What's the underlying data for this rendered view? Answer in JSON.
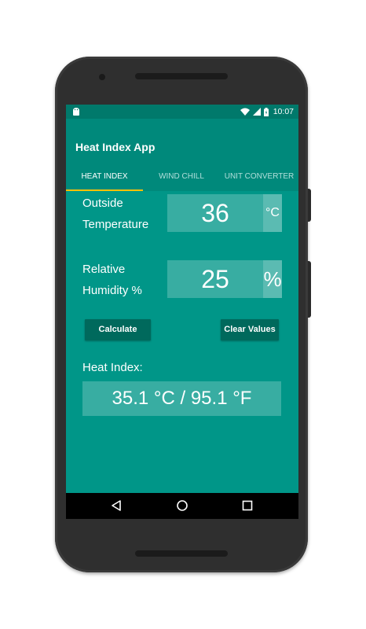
{
  "status_bar": {
    "time": "10:07",
    "icons": [
      "android-notification-icon",
      "wifi-icon",
      "signal-icon",
      "battery-icon"
    ]
  },
  "app_bar": {
    "title": "Heat Index App",
    "tabs": [
      {
        "label": "HEAT INDEX",
        "active": true
      },
      {
        "label": "WIND CHILL",
        "active": false
      },
      {
        "label": "UNIT CONVERTER",
        "active": false
      }
    ]
  },
  "form": {
    "temperature": {
      "label_line1": "Outside",
      "label_line2": "Temperature",
      "value": "36",
      "unit": "°C"
    },
    "humidity": {
      "label_line1": "Relative",
      "label_line2": "Humidity %",
      "value": "25",
      "unit": "%"
    },
    "calculate_label": "Calculate",
    "clear_label": "Clear Values"
  },
  "result": {
    "label": "Heat Index:",
    "value": "35.1 °C / 95.1 °F"
  },
  "nav_bar": {
    "icons": [
      "back-icon",
      "home-icon",
      "recents-icon"
    ]
  },
  "colors": {
    "primary": "#009688",
    "primary_dark": "#00796b",
    "accent": "#ffc107",
    "button": "#00695c"
  }
}
